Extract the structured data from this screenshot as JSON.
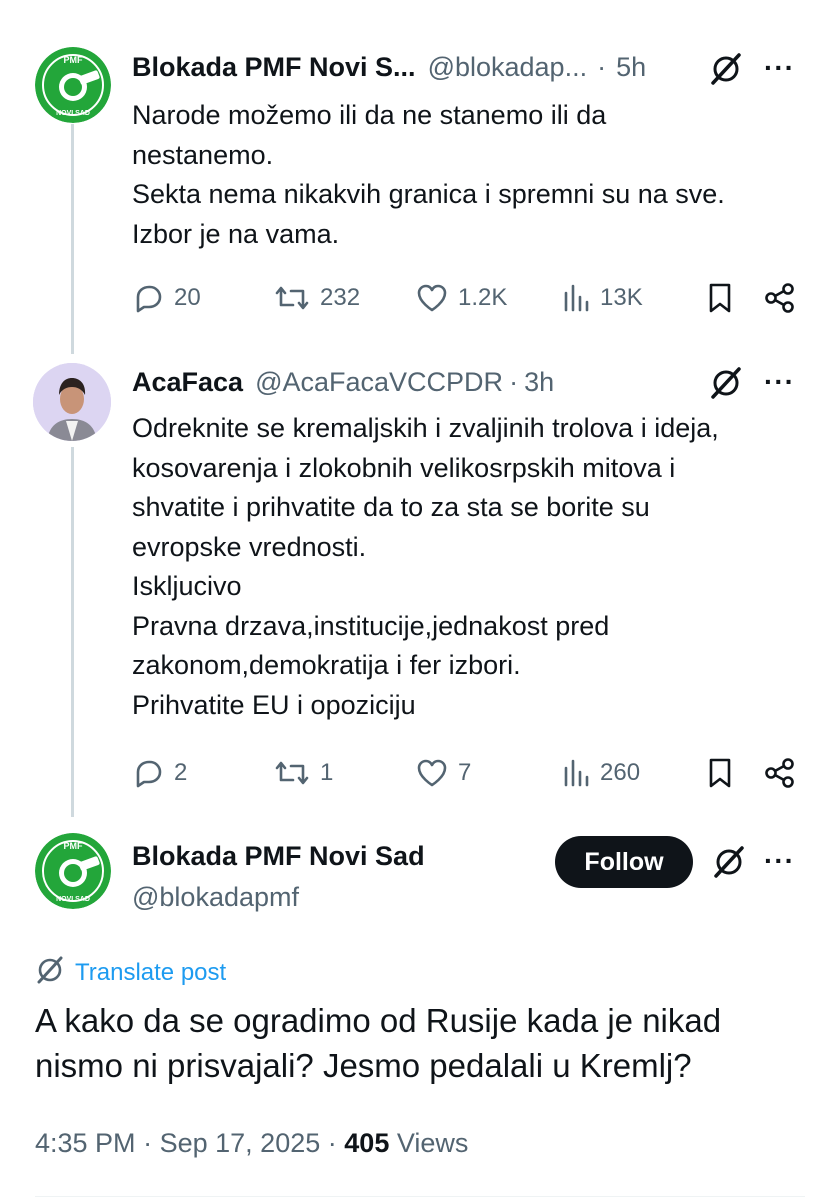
{
  "tweet1": {
    "name": "Blokada PMF Novi S...",
    "handle": "@blokadap...",
    "sep": "·",
    "time": "5h",
    "more": "···",
    "avatar_label": "PMF",
    "avatar_sublabel": "NOVI SAD",
    "lines": [
      "Narode možemo ili da ne stanemo ili da",
      "nestanemo.",
      "Sekta nema nikakvih granica i spremni su na sve.",
      "Izbor je na vama."
    ],
    "replies": "20",
    "reposts": "232",
    "likes": "1.2K",
    "views": "13K"
  },
  "tweet2": {
    "name": "AcaFaca",
    "handle": "@AcaFacaVCCPDR",
    "sep": "·",
    "time": "3h",
    "more": "···",
    "lines": [
      "Odreknite se kremaljskih i zvaljinih trolova i ideja,",
      "kosovarenja i zlokobnih velikosrpskih mitova i",
      "shvatite i prihvatite da to za sta se borite su",
      "evropske vrednosti.",
      "Iskljucivo",
      "Pravna drzava,institucije,jednakost pred",
      "zakonom,demokratija i fer izbori.",
      "Prihvatite EU i opoziciju"
    ],
    "replies": "2",
    "reposts": "1",
    "likes": "7",
    "views": "260"
  },
  "main": {
    "name": "Blokada PMF Novi Sad",
    "handle": "@blokadapmf",
    "follow_label": "Follow",
    "more": "···",
    "avatar_label": "PMF",
    "avatar_sublabel": "NOVI SAD",
    "translate": "Translate post",
    "lines": [
      "A kako da se ogradimo od Rusije kada je nikad",
      "nismo ni prisvajali? Jesmo pedalali u Kremlj?"
    ],
    "time": "4:35 PM",
    "sep1": "·",
    "date": "Sep 17, 2025",
    "sep2": "·",
    "views_count": "405",
    "views_label": "Views"
  },
  "colors": {
    "accent": "#1d9bf0",
    "logo_green": "#23a63a",
    "muted": "#536471"
  },
  "icons": [
    "reply-icon",
    "repost-icon",
    "like-icon",
    "views-icon",
    "bookmark-icon",
    "share-icon",
    "grok-icon",
    "translate-icon"
  ]
}
